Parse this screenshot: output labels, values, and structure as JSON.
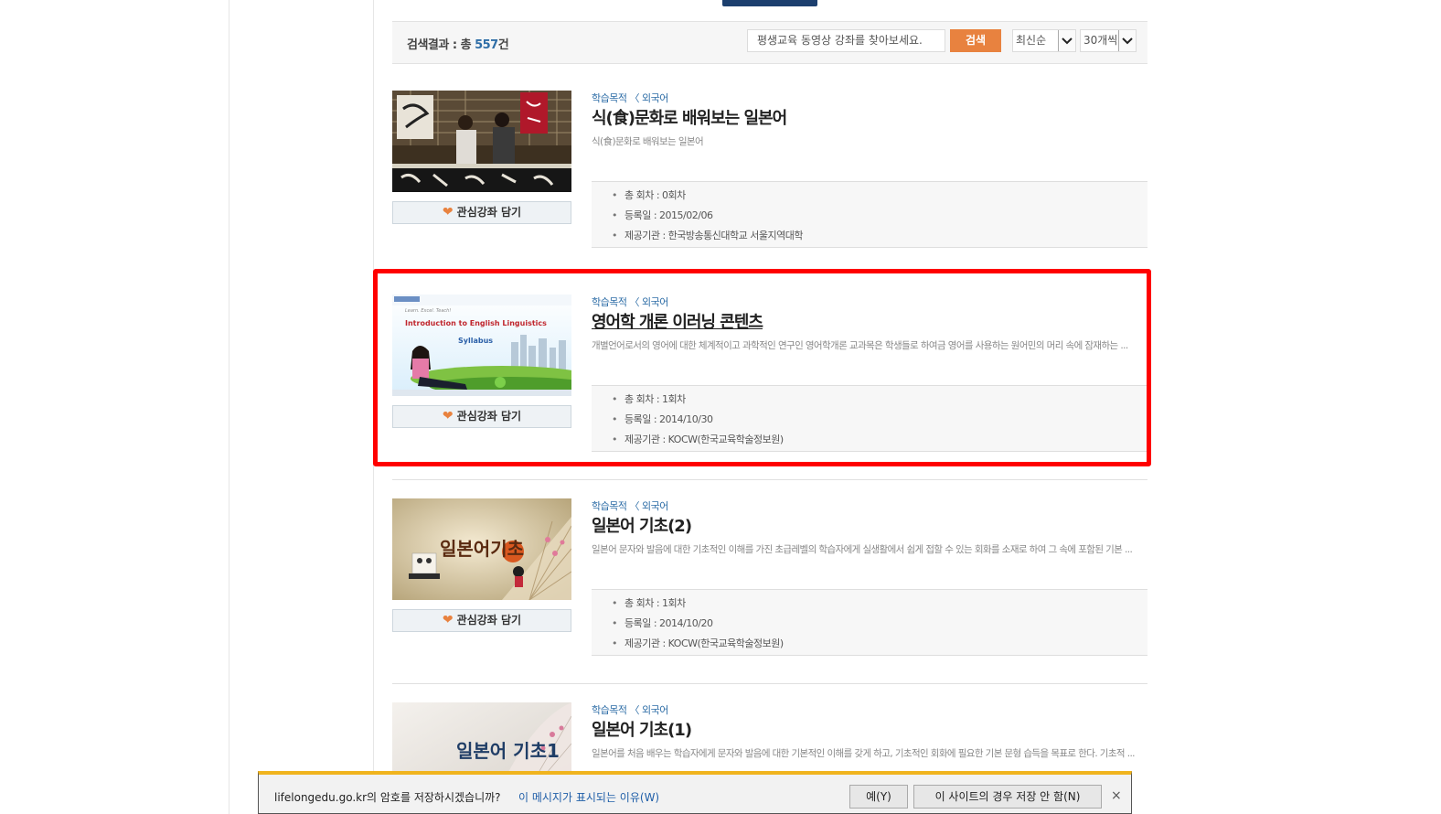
{
  "search": {
    "result_label": "검색결과 : 총 ",
    "result_count": "557",
    "result_suffix": "건",
    "placeholder": "평생교육 동영상 강좌를 찾아보세요.",
    "button_label": "검색",
    "sort_value": "최신순",
    "per_page_value": "30개씩"
  },
  "courses": [
    {
      "category": "학습목적 〈 외국어",
      "title": "식(食)문화로 배워보는 일본어",
      "description": "식(食)문화로 배워보는 일본어",
      "sessions": "총 회차 : 0회차",
      "registered": "등록일 : 2015/02/06",
      "provider": "제공기관 : 한국방송통신대학교 서울지역대학",
      "fav_label": "관심강좌 담기"
    },
    {
      "category": "학습목적 〈 외국어",
      "title": "영어학 개론 이러닝 콘텐츠",
      "description": "개별언어로서의 영어에 대한 체계적이고 과학적인 연구인 영어학개론 교과목은 학생들로 하여금 영어를 사용하는 원어민의 머리 속에 잠재하는 ...",
      "sessions": "총 회차 : 1회차",
      "registered": "등록일 : 2014/10/30",
      "provider": "제공기관 : KOCW(한국교육학술정보원)",
      "fav_label": "관심강좌 담기",
      "thumb_text": {
        "slogan": "Learn. Excel. Teach!",
        "title": "Introduction to English Linguistics",
        "subtitle": "Syllabus"
      }
    },
    {
      "category": "학습목적 〈 외국어",
      "title": "일본어 기초(2)",
      "description": "일본어 문자와 발음에 대한 기초적인 이해를 가진 초급레벨의 학습자에게 실생활에서 쉽게 접할 수 있는 회화를 소재로 하여 그 속에 포함된 기본 ...",
      "sessions": "총 회차 : 1회차",
      "registered": "등록일 : 2014/10/20",
      "provider": "제공기관 : KOCW(한국교육학술정보원)",
      "fav_label": "관심강좌 담기",
      "thumb_text": "일본어기초"
    },
    {
      "category": "학습목적 〈 외국어",
      "title": "일본어 기초(1)",
      "description": "일본어를 처음 배우는 학습자에게 문자와 발음에 대한 기본적인 이해를 갖게 하고, 기초적인 회화에 필요한 기본 문형 습득을 목표로 한다. 기초적 ...",
      "thumb_text": "일본어 기초1"
    }
  ],
  "password_bar": {
    "message": "lifelongedu.go.kr의 암호를 저장하시겠습니까?",
    "why_link": "이 메시지가 표시되는 이유(W)",
    "yes_label": "예(Y)",
    "never_label": "이 사이트의 경우 저장 안 함(N)",
    "close_glyph": "×"
  },
  "colors": {
    "accent": "#e8823f",
    "link": "#2f6ea7",
    "highlight": "#ff0000",
    "header_tab": "#1c3f6e"
  }
}
